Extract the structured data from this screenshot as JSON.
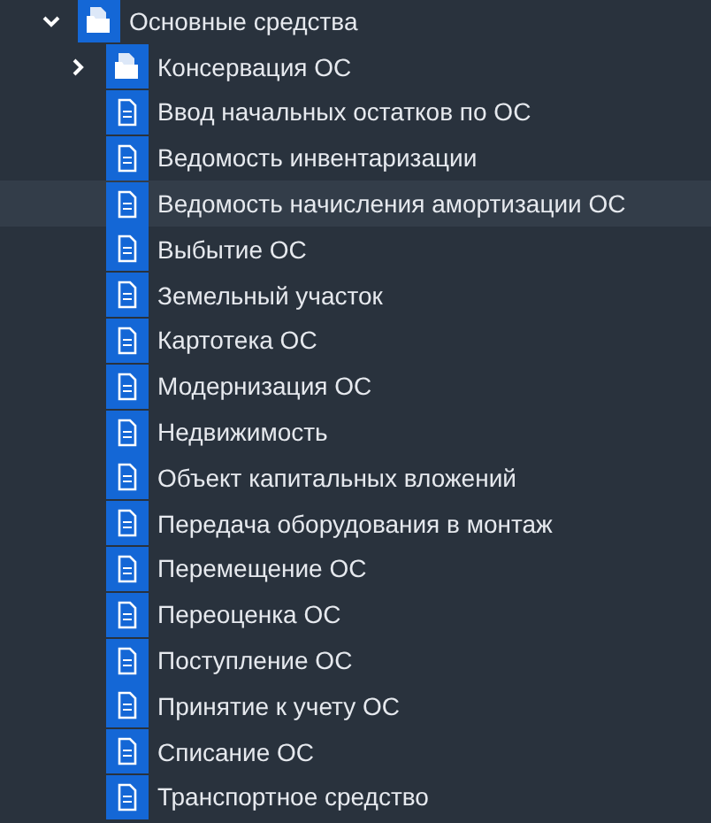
{
  "tree": [
    {
      "label": "Основные средства",
      "kind": "folder",
      "expanded": true,
      "selected": false,
      "children": [
        {
          "label": "Консервация ОС",
          "kind": "folder",
          "expanded": false,
          "selected": false
        },
        {
          "label": "Ввод начальных остатков по ОС",
          "kind": "document",
          "selected": false
        },
        {
          "label": "Ведомость инвентаризации",
          "kind": "document",
          "selected": false
        },
        {
          "label": "Ведомость начисления амортизации ОС",
          "kind": "document",
          "selected": true
        },
        {
          "label": "Выбытие ОС",
          "kind": "document",
          "selected": false
        },
        {
          "label": "Земельный участок",
          "kind": "document",
          "selected": false
        },
        {
          "label": "Картотека ОС",
          "kind": "document",
          "selected": false
        },
        {
          "label": "Модернизация ОС",
          "kind": "document",
          "selected": false
        },
        {
          "label": "Недвижимость",
          "kind": "document",
          "selected": false
        },
        {
          "label": "Объект капитальных вложений",
          "kind": "document",
          "selected": false
        },
        {
          "label": "Передача оборудования в монтаж",
          "kind": "document",
          "selected": false
        },
        {
          "label": "Перемещение ОС",
          "kind": "document",
          "selected": false
        },
        {
          "label": "Переоценка ОС",
          "kind": "document",
          "selected": false
        },
        {
          "label": "Поступление ОС",
          "kind": "document",
          "selected": false
        },
        {
          "label": "Принятие к учету ОС",
          "kind": "document",
          "selected": false
        },
        {
          "label": "Списание ОС",
          "kind": "document",
          "selected": false
        },
        {
          "label": "Транспортное средство",
          "kind": "document",
          "selected": false
        }
      ]
    }
  ]
}
